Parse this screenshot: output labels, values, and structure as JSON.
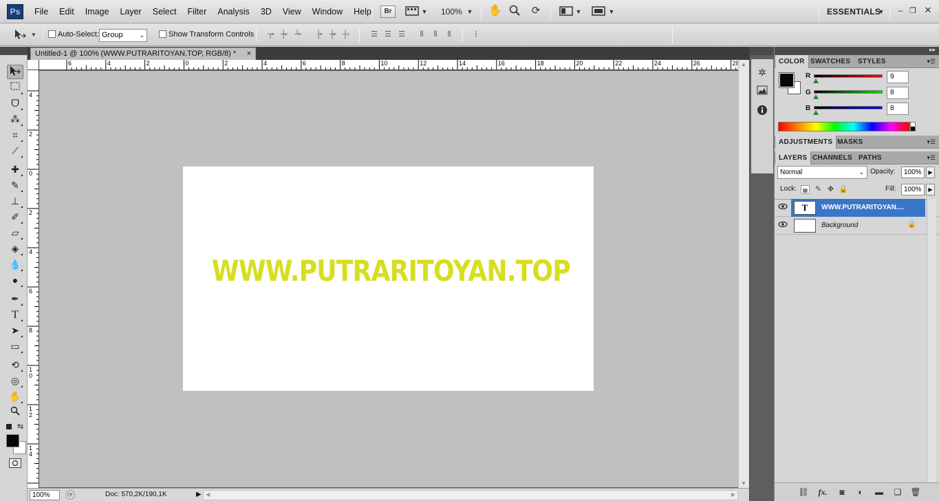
{
  "app": {
    "logo": "Ps",
    "essentials": "ESSENTIALS"
  },
  "menu": [
    "File",
    "Edit",
    "Image",
    "Layer",
    "Select",
    "Filter",
    "Analysis",
    "3D",
    "View",
    "Window",
    "Help"
  ],
  "appbar": {
    "bridge_label": "Br",
    "zoom": "100%"
  },
  "options": {
    "auto_select_label": "Auto-Select:",
    "auto_select_value": "Group",
    "show_transform_label": "Show Transform Controls"
  },
  "document": {
    "tab_title": "Untitled-1 @ 100% (WWW.PUTRARITOYAN.TOP, RGB/8) *",
    "close": "×",
    "canvas_text": "WWW.PUTRARITOYAN.TOP",
    "text_color": "#d7de1f"
  },
  "ruler": {
    "h_labels": [
      "6",
      "4",
      "2",
      "0",
      "2",
      "4",
      "6",
      "8",
      "10",
      "12",
      "14",
      "16",
      "18",
      "20",
      "22",
      "24",
      "26",
      "28"
    ],
    "v_labels": [
      "4",
      "2",
      "0",
      "2",
      "4",
      "6",
      "8",
      "1\n0",
      "1\n2",
      "1\n4"
    ]
  },
  "status": {
    "zoom": "100%",
    "doc_info": "Doc: 570,2K/190,1K"
  },
  "color_panel": {
    "tabs": [
      "COLOR",
      "SWATCHES",
      "STYLES"
    ],
    "r_label": "R",
    "r_value": "9",
    "g_label": "G",
    "g_value": "8",
    "b_label": "B",
    "b_value": "8",
    "fg_color": "#090808",
    "bg_color": "#ffffff"
  },
  "adjust_panel": {
    "tabs": [
      "ADJUSTMENTS",
      "MASKS"
    ]
  },
  "layers_panel": {
    "tabs": [
      "LAYERS",
      "CHANNELS",
      "PATHS"
    ],
    "blend_mode": "Normal",
    "opacity_label": "Opacity:",
    "opacity_value": "100%",
    "lock_label": "Lock:",
    "fill_label": "Fill:",
    "fill_value": "100%",
    "layers": [
      {
        "name": "WWW.PUTRARITOYAN....",
        "thumb": "T",
        "selected": true
      },
      {
        "name": "Background",
        "thumb": "",
        "selected": false
      }
    ]
  }
}
